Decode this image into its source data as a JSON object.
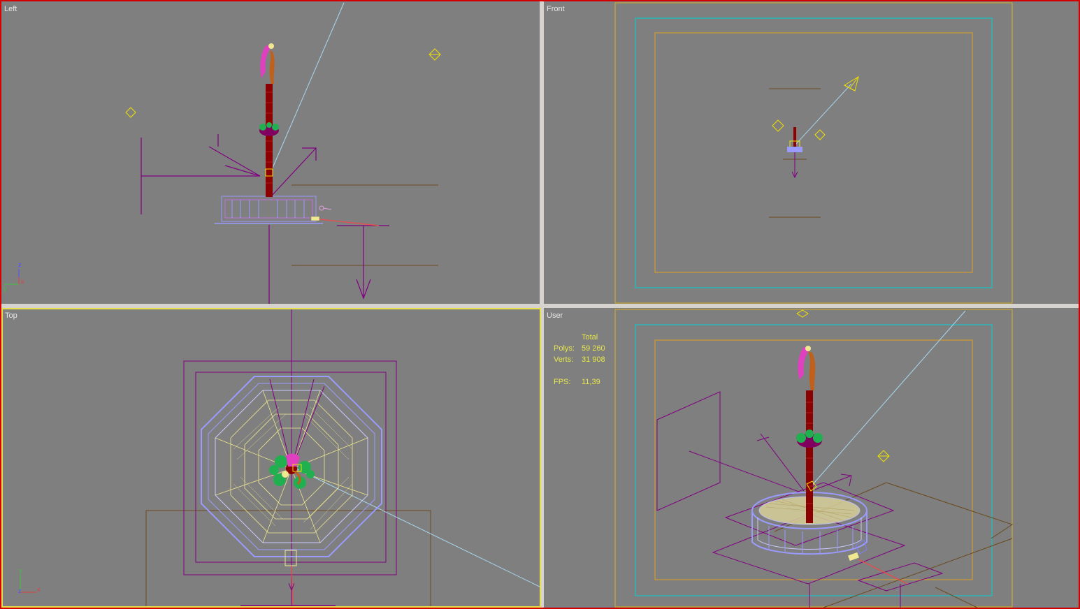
{
  "viewports": {
    "left": {
      "label": "Left"
    },
    "front": {
      "label": "Front"
    },
    "top": {
      "label": "Top"
    },
    "user": {
      "label": "User"
    }
  },
  "stats": {
    "header": "Total",
    "polys_label": "Polys:",
    "polys_value": "59 260",
    "verts_label": "Verts:",
    "verts_value": "31 908",
    "fps_label": "FPS:",
    "fps_value": "11,39"
  },
  "axes": {
    "left": {
      "up": "z",
      "side": "x",
      "origin": "y"
    },
    "top": {
      "up": "y",
      "side": "x",
      "origin": "z"
    }
  },
  "colors": {
    "viewport_bg": "#7f7f7f",
    "active_border": "#e8e04a",
    "frame_border": "#d40000",
    "stats_text": "#e8e84a",
    "camera_yellow": "#f0e000",
    "safe_frame_cyan": "#00d0d0",
    "safe_frame_orange": "#e0a020",
    "helper_purple": "#800080",
    "mesh_blue": "#9a9aff",
    "mesh_yellow": "#f0e890",
    "tower_red": "#8b0000",
    "plant_green": "#20b050",
    "figure_pink": "#e040c0",
    "figure_orange": "#c0601a",
    "light_cyan": "#a8d8f0"
  },
  "active_viewport": "top"
}
